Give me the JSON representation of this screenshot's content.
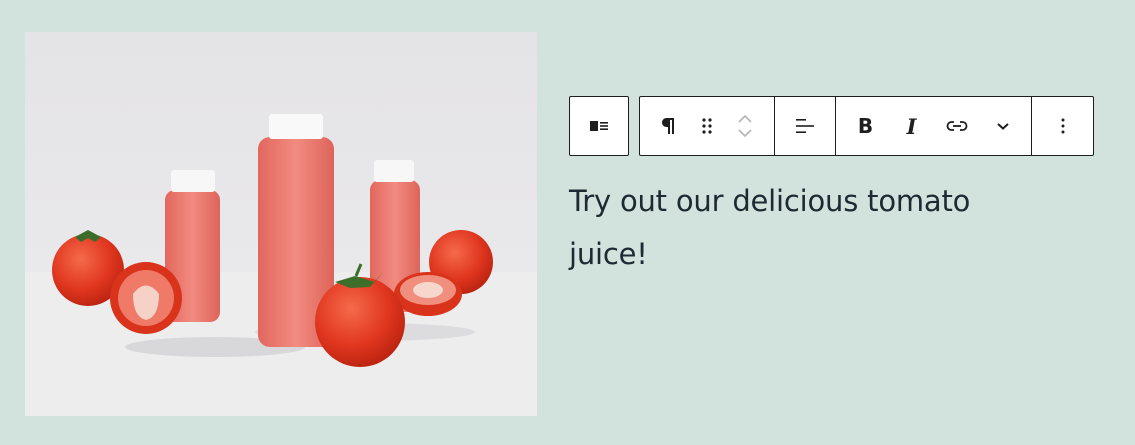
{
  "image": {
    "alt_icon": "tomato-juice-photo"
  },
  "toolbar": {
    "media_text_icon": "media-text-icon",
    "paragraph_icon": "paragraph-icon",
    "drag_icon": "drag-handle-icon",
    "move_up_icon": "chevron-up-icon",
    "move_down_icon": "chevron-down-icon",
    "align_icon": "align-left-icon",
    "bold_label": "B",
    "italic_label": "I",
    "link_icon": "link-icon",
    "more_icon": "chevron-down-icon",
    "options_icon": "more-vertical-icon"
  },
  "paragraph": {
    "text": "Try out our delicious tomato juice!"
  },
  "colors": {
    "background": "#d2e3de",
    "toolbar_border": "#1e1e1e",
    "text": "#1e2a31"
  }
}
